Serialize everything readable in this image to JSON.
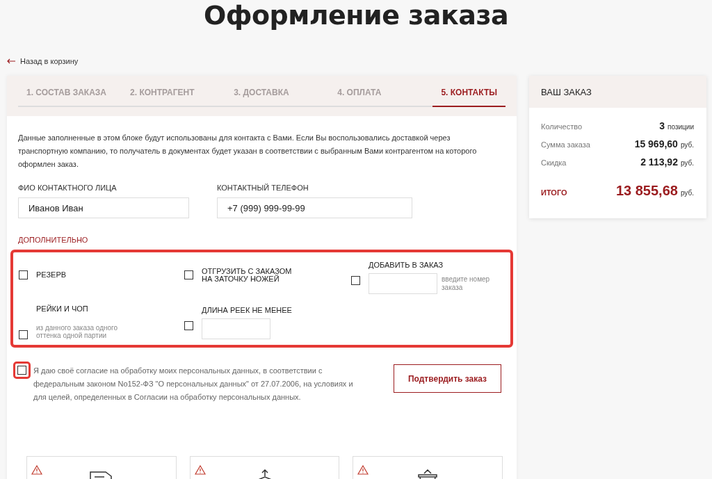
{
  "page_title": "Оформление заказа",
  "back_link": "Назад в корзину",
  "tabs": [
    {
      "label": "1. СОСТАВ ЗАКАЗА",
      "selected": false
    },
    {
      "label": "2. КОНТРАГЕНТ",
      "selected": false
    },
    {
      "label": "3. ДОСТАВКА",
      "selected": false
    },
    {
      "label": "4. ОПЛАТА",
      "selected": false
    },
    {
      "label": "5. КОНТАКТЫ",
      "selected": true
    }
  ],
  "intro": "Данные заполненные в этом блоке будут использованы для контакта с Вами. Если Вы воспользовались доставкой через транспортную компанию, то получатель в документах будет указан в соответствии с выбранным Вами контрагентом на которого оформлен заказ.",
  "fields": [
    {
      "label": "ФИО КОНТАКТНОГО ЛИЦА",
      "value": "Иванов Иван"
    },
    {
      "label": "КОНТАКТНЫЙ ТЕЛЕФОН",
      "value": "+7 (999) 999-99-99"
    }
  ],
  "extras": {
    "title": "ДОПОЛНИТЕЛЬНО",
    "highlighted": true,
    "rows": [
      [
        {
          "kind": "check",
          "label": "РЕЗЕРВ",
          "checked": false
        },
        {
          "kind": "check",
          "label": "ОТГРУЗИТЬ С ЗАКАЗОМ НА ЗАТОЧКУ НОЖЕЙ",
          "checked": false
        },
        {
          "kind": "field",
          "label": "ДОБАВИТЬ В ЗАКАЗ",
          "checked": false,
          "hint": "введите номер заказа"
        }
      ],
      [
        {
          "kind": "note",
          "label": "РЕЙКИ И ЧОП",
          "checked": false,
          "note": "из данного заказа одного оттенка одной партии"
        },
        {
          "kind": "field",
          "label": "ДЛИНА РЕЕК НЕ МЕНЕЕ",
          "checked": false
        }
      ]
    ]
  },
  "consent": {
    "text": "Я даю своё согласие на обработку моих персональных данных, в соответствии с федеральным законом No152-ФЗ \"О персональных данных\" от 27.07.2006, на условиях и для целей, определенных в Согласии на обработку персональных данных.",
    "checked": false,
    "highlighted": true
  },
  "confirm_button": "Подтвердить заказ",
  "info_cards": [
    {
      "kind": "delivery"
    },
    {
      "kind": "pickup"
    },
    {
      "kind": "basket"
    }
  ],
  "summary": {
    "title": "ВАШ ЗАКАЗ",
    "rows": [
      {
        "label": "Количество",
        "value": "3",
        "unit": "позиции"
      },
      {
        "label": "Сумма заказа",
        "value": "15 969,60",
        "unit": "руб."
      },
      {
        "label": "Скидка",
        "value": "2 113,92",
        "unit": "руб."
      }
    ],
    "total": {
      "label": "ИТОГО",
      "value": "13 855,68",
      "unit": "руб."
    }
  }
}
